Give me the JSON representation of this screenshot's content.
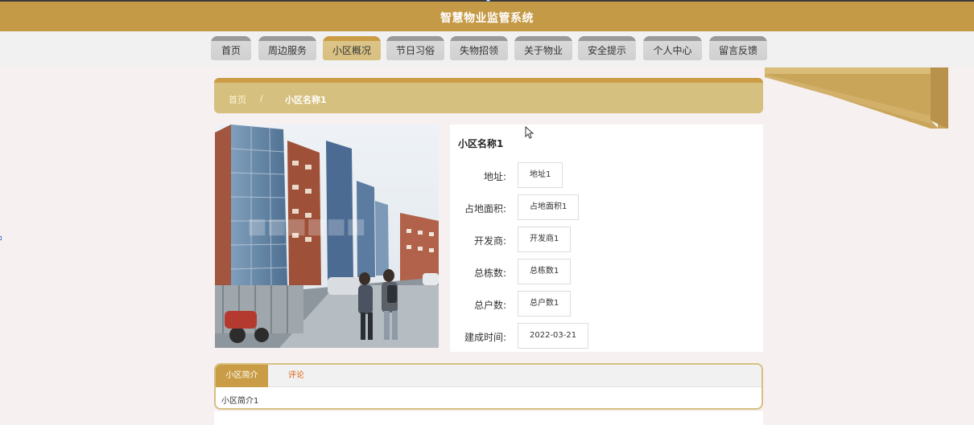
{
  "header": {
    "title": "智慧物业监管系统"
  },
  "nav": [
    {
      "label": "首页",
      "active": false
    },
    {
      "label": "周边服务",
      "active": false
    },
    {
      "label": "小区概况",
      "active": true
    },
    {
      "label": "节日习俗",
      "active": false
    },
    {
      "label": "失物招领",
      "active": false
    },
    {
      "label": "关于物业",
      "active": false
    },
    {
      "label": "安全提示",
      "active": false
    },
    {
      "label": "个人中心",
      "active": false
    },
    {
      "label": "留言反馈",
      "active": false
    }
  ],
  "breadcrumb": {
    "home": "首页",
    "separator": "/",
    "current": "小区名称1"
  },
  "detail": {
    "name": "小区名称1",
    "fields": [
      {
        "label": "地址:",
        "value": "地址1"
      },
      {
        "label": "占地面积:",
        "value": "占地面积1"
      },
      {
        "label": "开发商:",
        "value": "开发商1"
      },
      {
        "label": "总栋数:",
        "value": "总栋数1"
      },
      {
        "label": "总户数:",
        "value": "总户数1"
      },
      {
        "label": "建成时间:",
        "value": "2022-03-21"
      }
    ]
  },
  "tabs": {
    "items": [
      {
        "label": "小区简介",
        "active": true
      },
      {
        "label": "评论",
        "active": false
      }
    ],
    "content": "小区简介1"
  },
  "colors": {
    "brand": "#c59a46",
    "breadcrumb": "#d6c07f",
    "comment_tab": "#e0651a"
  }
}
